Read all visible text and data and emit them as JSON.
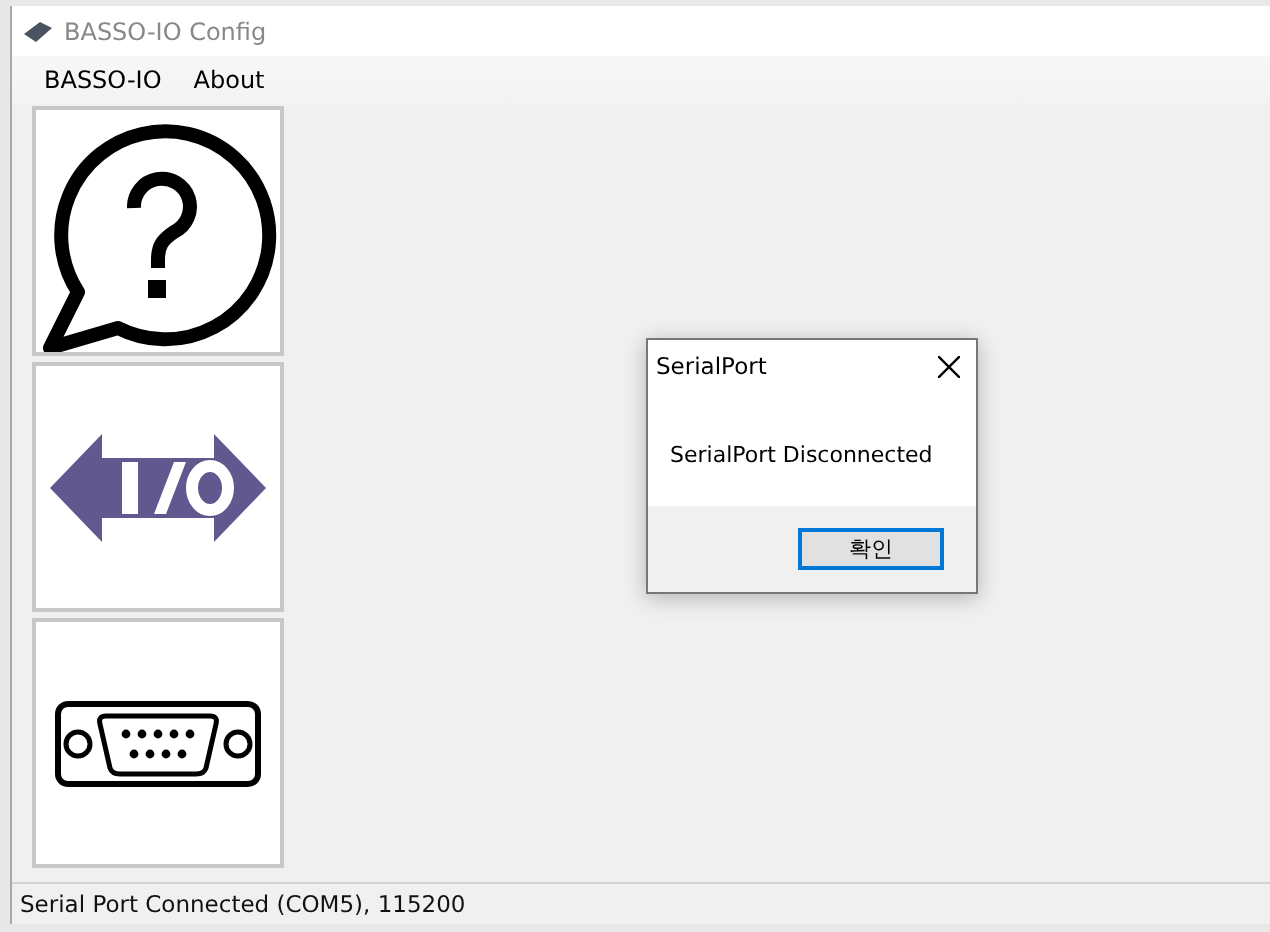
{
  "window": {
    "title": "BASSO-IO Config"
  },
  "menu": [
    "BASSO-IO",
    "About"
  ],
  "tiles": [
    {
      "kind": "help"
    },
    {
      "kind": "io"
    },
    {
      "kind": "serial"
    }
  ],
  "dialog": {
    "title": "SerialPort",
    "message": "SerialPort Disconnected",
    "button": "확인"
  },
  "status_bar": "Serial Port Connected (COM5), 115200"
}
